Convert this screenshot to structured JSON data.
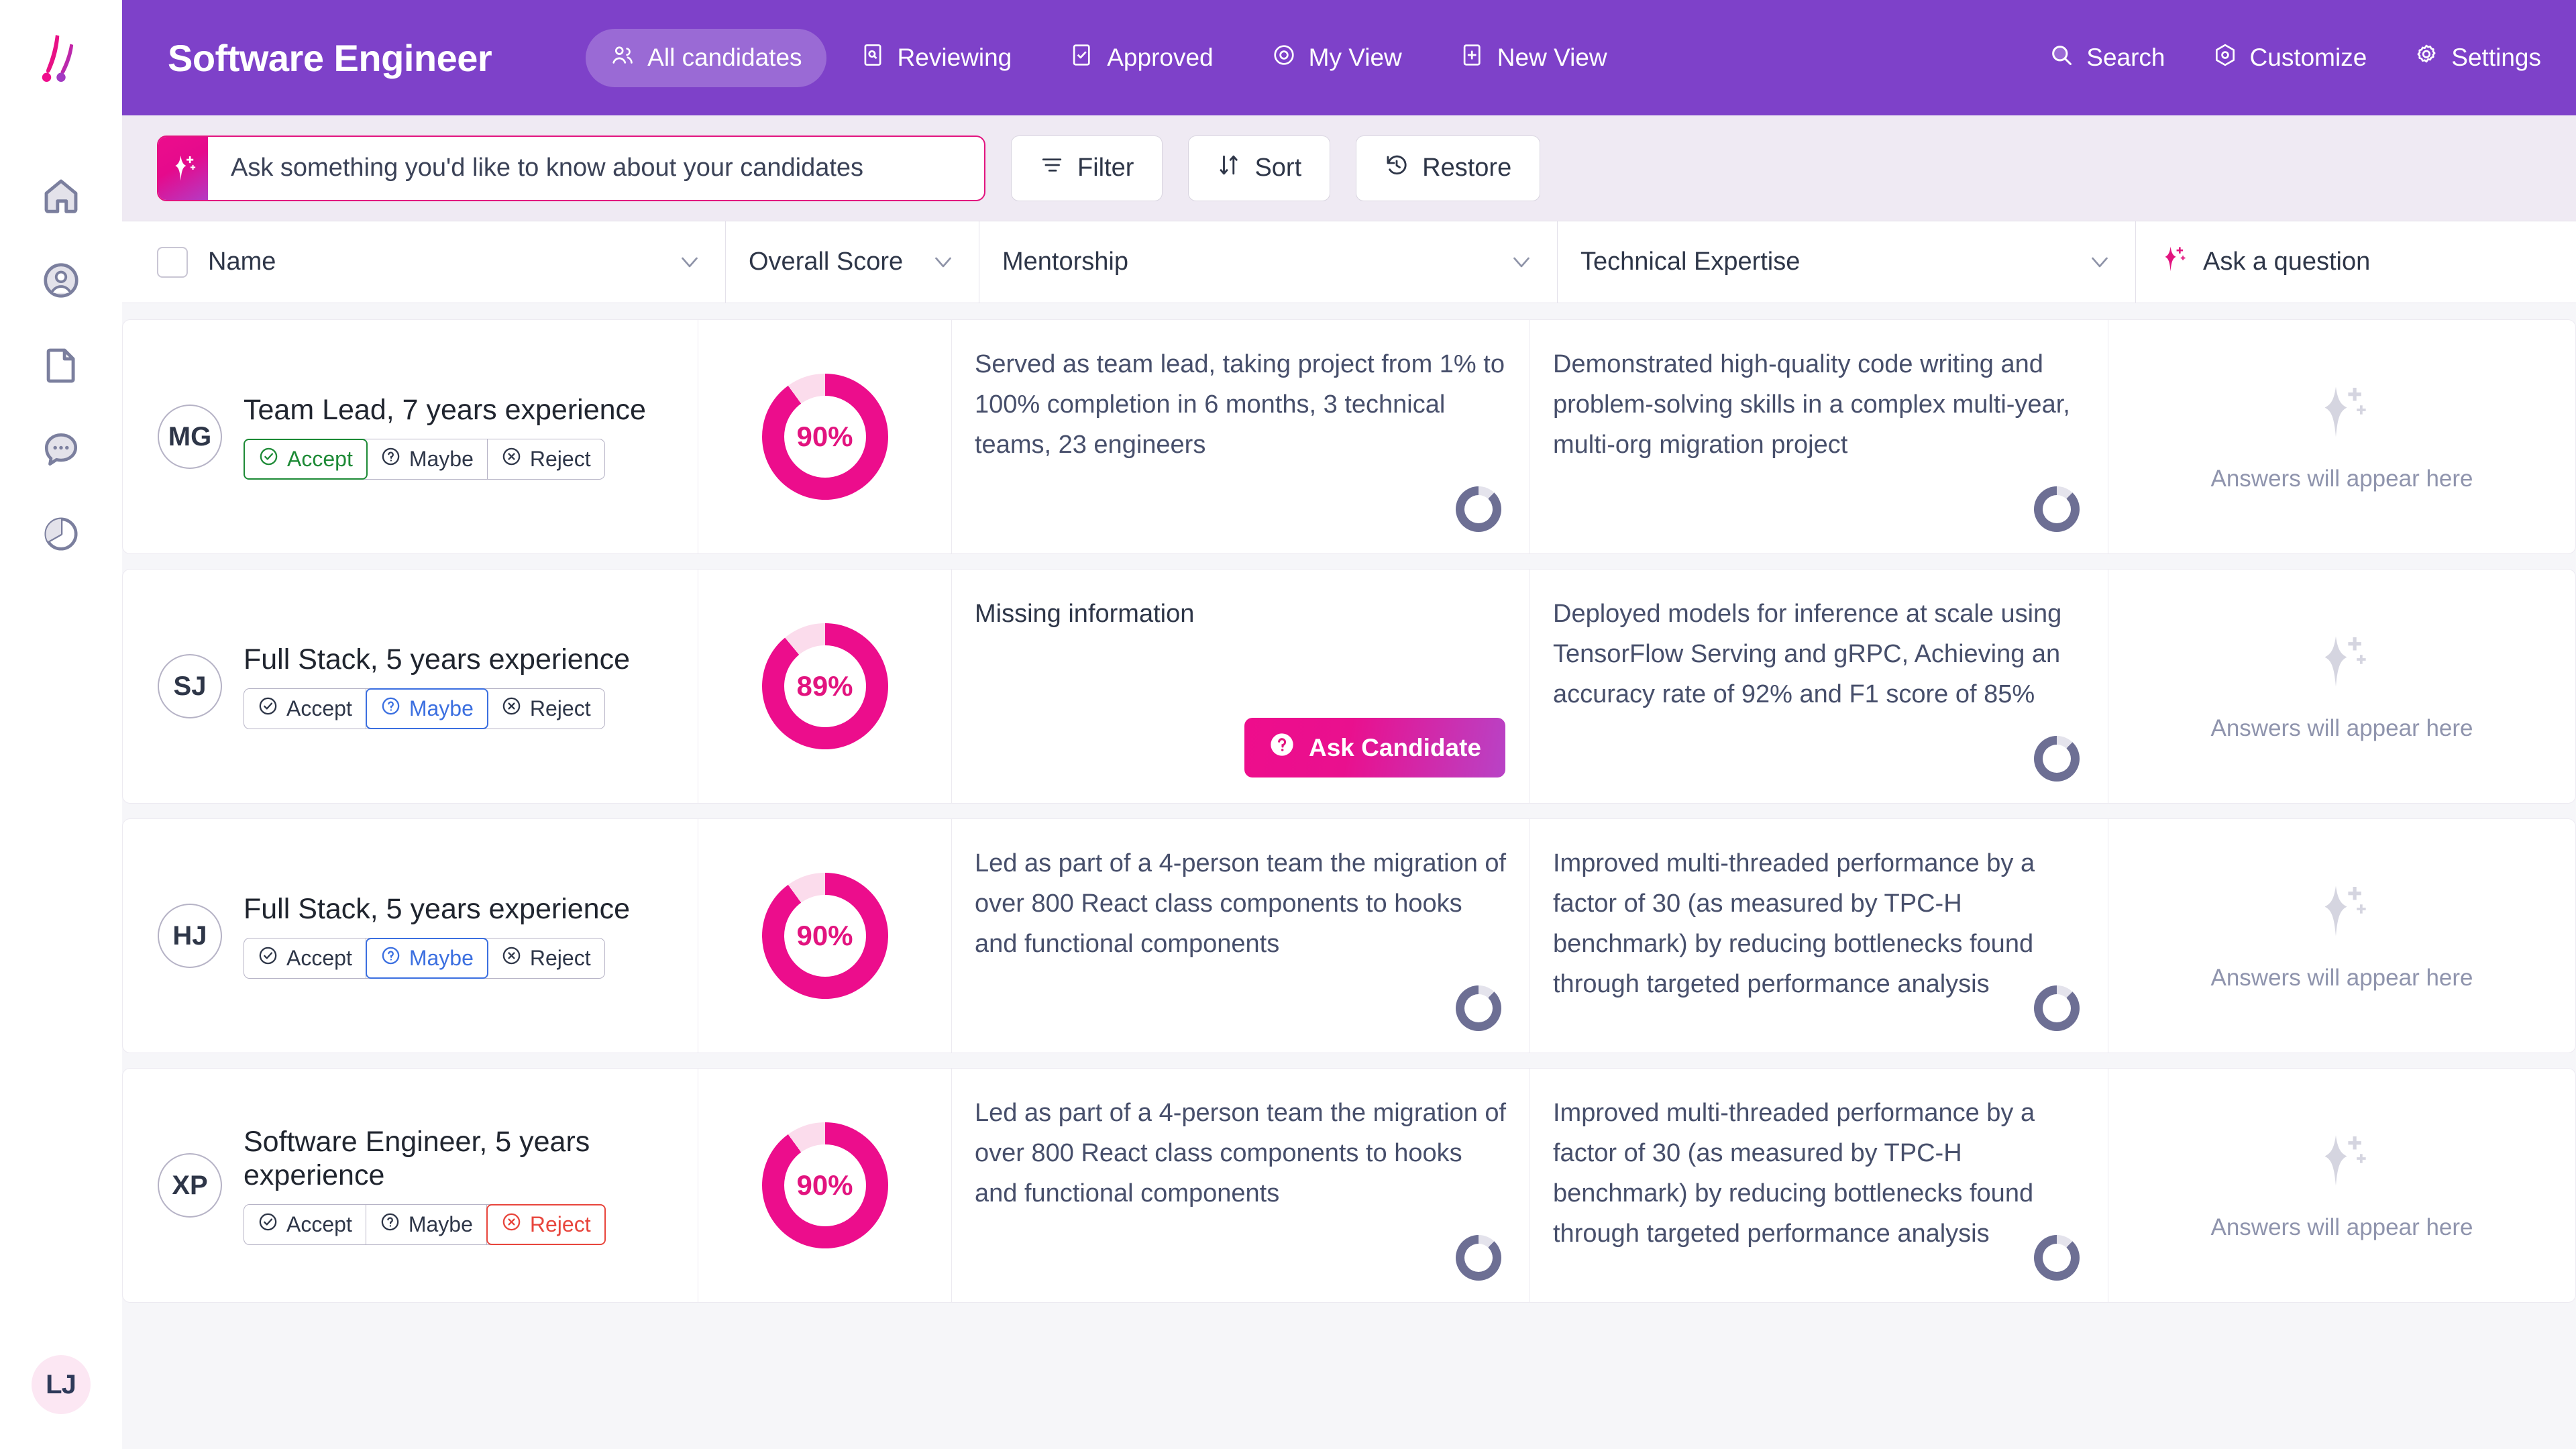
{
  "sidebar": {
    "logo_name": "brand-logo",
    "items": [
      {
        "name": "home",
        "label": "Home"
      },
      {
        "name": "profile",
        "label": "Profile"
      },
      {
        "name": "documents",
        "label": "Documents"
      },
      {
        "name": "messages",
        "label": "Messages"
      },
      {
        "name": "analytics",
        "label": "Analytics"
      }
    ],
    "user_initials": "LJ"
  },
  "header": {
    "title": "Software Engineer",
    "accent_purple": "#7e41c9",
    "tabs": [
      {
        "label": "All candidates",
        "icon": "people-icon",
        "active": true
      },
      {
        "label": "Reviewing",
        "icon": "document-search-icon",
        "active": false
      },
      {
        "label": "Approved",
        "icon": "checkbox-icon",
        "active": false
      },
      {
        "label": "My View",
        "icon": "eye-icon",
        "active": false
      },
      {
        "label": "New View",
        "icon": "plus-square-icon",
        "active": false
      }
    ],
    "actions": [
      {
        "label": "Search",
        "icon": "search-icon"
      },
      {
        "label": "Customize",
        "icon": "hexagon-target-icon"
      },
      {
        "label": "Settings",
        "icon": "gear-icon"
      }
    ]
  },
  "toolbar": {
    "ai_placeholder": "Ask something you'd like to know about your candidates",
    "ai_value": "",
    "accent_pink": "#e2147f",
    "buttons": [
      {
        "label": "Filter",
        "icon": "filter-icon"
      },
      {
        "label": "Sort",
        "icon": "sort-icon"
      },
      {
        "label": "Restore",
        "icon": "restore-icon"
      }
    ]
  },
  "table": {
    "columns": [
      {
        "key": "name",
        "label": "Name",
        "sortable": true
      },
      {
        "key": "score",
        "label": "Overall Score",
        "sortable": true
      },
      {
        "key": "mentorship",
        "label": "Mentorship",
        "sortable": true
      },
      {
        "key": "technical",
        "label": "Technical Expertise",
        "sortable": true
      },
      {
        "key": "ask",
        "label": "Ask a question",
        "sortable": false
      }
    ],
    "ask_placeholder_text": "Answers will appear here",
    "ask_candidate_label": "Ask Candidate",
    "decision_labels": {
      "accept": "Accept",
      "maybe": "Maybe",
      "reject": "Reject"
    },
    "rows": [
      {
        "initials": "MG",
        "name": "Team Lead, 7 years experience",
        "decision": "accept",
        "score": 90,
        "score_label": "90%",
        "mentorship": "Served as team lead, taking project from 1% to 100% completion in 6 months, 3 technical teams, 23 engineers",
        "mentorship_missing": false,
        "technical": "Demonstrated high-quality code writing and problem-solving skills in a complex multi-year, multi-org migration project",
        "answer": ""
      },
      {
        "initials": "SJ",
        "name": "Full Stack, 5 years experience",
        "decision": "maybe",
        "score": 89,
        "score_label": "89%",
        "mentorship": "Missing information",
        "mentorship_missing": true,
        "technical": "Deployed models for inference at scale using TensorFlow Serving and gRPC, Achieving an accuracy rate of 92% and F1 score of 85%",
        "answer": ""
      },
      {
        "initials": "HJ",
        "name": "Full Stack, 5 years experience",
        "decision": "maybe",
        "score": 90,
        "score_label": "90%",
        "mentorship": "Led as part of a 4-person team the migration of over 800 React class  components to hooks and functional components",
        "mentorship_missing": false,
        "technical": "Improved multi-threaded performance by a factor of 30 (as measured by TPC-H benchmark) by reducing bottlenecks found through targeted performance analysis",
        "answer": ""
      },
      {
        "initials": "XP",
        "name": "Software Engineer, 5 years experience",
        "decision": "reject",
        "score": 90,
        "score_label": "90%",
        "mentorship": "Led as part of a 4-person team the migration of over 800 React class  components to hooks and functional components",
        "mentorship_missing": false,
        "technical": "Improved multi-threaded performance by a factor of 30 (as measured by TPC-H benchmark) by reducing bottlenecks found through targeted performance analysis",
        "answer": ""
      }
    ]
  }
}
